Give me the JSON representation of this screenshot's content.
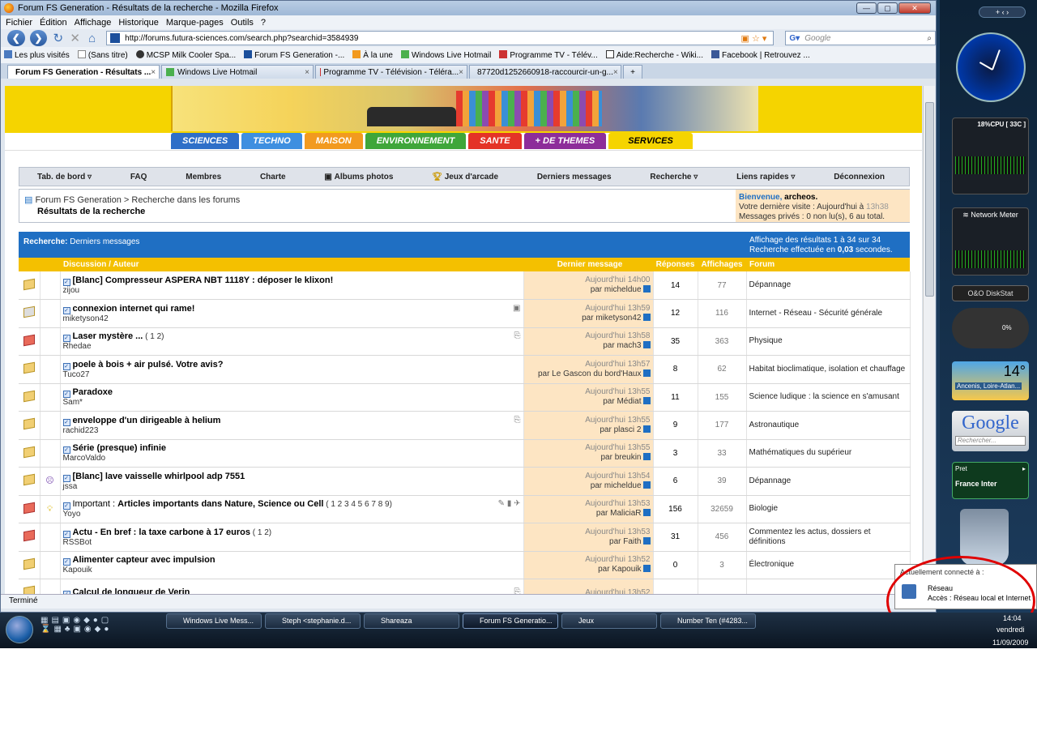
{
  "window": {
    "title": "Forum FS Generation - Résultats de la recherche - Mozilla Firefox"
  },
  "menu": [
    "Fichier",
    "Édition",
    "Affichage",
    "Historique",
    "Marque-pages",
    "Outils",
    "?"
  ],
  "url": "http://forums.futura-sciences.com/search.php?searchid=3584939",
  "search_placeholder": "Google",
  "bookmarks": [
    "Les plus visités",
    "(Sans titre)",
    "MCSP Milk Cooler Spa...",
    "Forum FS Generation -...",
    "À la une",
    "Windows Live Hotmail",
    "Programme TV - Télév...",
    "Aide:Recherche - Wiki...",
    "Facebook | Retrouvez ..."
  ],
  "tabs": [
    "Forum FS Generation - Résultats ...",
    "Windows Live Hotmail",
    "Programme TV - Télévision - Téléra...",
    "87720d1252660918-raccourcir-un-g..."
  ],
  "categories": [
    {
      "label": "SCIENCES",
      "color": "#2f6fc8"
    },
    {
      "label": "TECHNO",
      "color": "#3e8fe0"
    },
    {
      "label": "MAISON",
      "color": "#f29a1f"
    },
    {
      "label": "ENVIRONNEMENT",
      "color": "#3fa63a"
    },
    {
      "label": "SANTE",
      "color": "#e43327"
    },
    {
      "label": "+ DE THEMES",
      "color": "#8d2d9a"
    },
    {
      "label": "SERVICES",
      "color": "#f5d400"
    }
  ],
  "forumnav": [
    "Tab. de bord",
    "FAQ",
    "Membres",
    "Charte",
    "Albums photos",
    "Jeux d'arcade",
    "Derniers messages",
    "Recherche",
    "Liens rapides",
    "Déconnexion"
  ],
  "breadcrumb": {
    "root": "Forum FS Generation",
    "sep": " > ",
    "sub": "Recherche dans les forums",
    "current": "Résultats de la recherche"
  },
  "welcome": {
    "prefix": "Bienvenue, ",
    "user": "archeos.",
    "last_visit": "Votre dernière visite : Aujourd'hui à ",
    "last_time": "13h38",
    "pm": "Messages privés : 0 non lu(s), 6 au total."
  },
  "results": {
    "label": "Recherche:",
    "sub": " Derniers messages",
    "info1": "Affichage des résultats 1 à 34 sur 34",
    "info2a": "Recherche effectuée en ",
    "info2b": "0,03",
    "info2c": " secondes."
  },
  "columns": [
    "Discussion / Auteur",
    "Dernier message",
    "Réponses",
    "Affichages",
    "Forum"
  ],
  "threads": [
    {
      "title": "[Blanc] Compresseur ASPERA NBT 1118Y : déposer le klixon!",
      "pages": "",
      "author": "zijou",
      "time": "Aujourd'hui 14h00",
      "by": "par micheldue",
      "replies": "14",
      "views": "77",
      "forum": "Dépannage",
      "icon": "normal"
    },
    {
      "title": "connexion internet qui rame!",
      "pages": "",
      "author": "miketyson42",
      "time": "Aujourd'hui 13h59",
      "by": "par miketyson42",
      "replies": "12",
      "views": "116",
      "forum": "Internet - Réseau - Sécurité générale",
      "icon": "grey"
    },
    {
      "title": "Laser mystère ...",
      "pages": "( 1 2)",
      "author": "Rhedae",
      "time": "Aujourd'hui 13h58",
      "by": "par mach3",
      "replies": "35",
      "views": "363",
      "forum": "Physique",
      "icon": "red"
    },
    {
      "title": "poele à bois + air pulsé. Votre avis?",
      "pages": "",
      "author": "Tuco27",
      "time": "Aujourd'hui 13h57",
      "by": "par Le Gascon du bord'Haux",
      "replies": "8",
      "views": "62",
      "forum": "Habitat bioclimatique, isolation et chauffage",
      "icon": "normal"
    },
    {
      "title": "Paradoxe",
      "pages": "",
      "author": "Sam*",
      "time": "Aujourd'hui 13h55",
      "by": "par Médiat",
      "replies": "11",
      "views": "155",
      "forum": "Science ludique : la science en s'amusant",
      "icon": "normal"
    },
    {
      "title": "enveloppe d'un dirigeable à helium",
      "pages": "",
      "author": "rachid223",
      "time": "Aujourd'hui 13h55",
      "by": "par plasci 2",
      "replies": "9",
      "views": "177",
      "forum": "Astronautique",
      "icon": "normal"
    },
    {
      "title": "Série (presque) infinie",
      "pages": "",
      "author": "MarcoValdo",
      "time": "Aujourd'hui 13h55",
      "by": "par breukin",
      "replies": "3",
      "views": "33",
      "forum": "Mathématiques du supérieur",
      "icon": "normal"
    },
    {
      "title": "[Blanc] lave vaisselle whirlpool adp 7551",
      "pages": "",
      "author": "jssa",
      "time": "Aujourd'hui 13h54",
      "by": "par micheldue",
      "replies": "6",
      "views": "39",
      "forum": "Dépannage",
      "icon": "normal"
    },
    {
      "title": "Articles importants dans Nature, Science ou Cell",
      "prefix": "Important : ",
      "pages": "( 1 2 3 4 5 6 7 8 9)",
      "author": "Yoyo",
      "time": "Aujourd'hui 13h53",
      "by": "par MaliciaR",
      "replies": "156",
      "views": "32659",
      "forum": "Biologie",
      "icon": "red"
    },
    {
      "title": "Actu - En bref : la taxe carbone à 17 euros",
      "pages": "( 1 2)",
      "author": "RSSBot",
      "time": "Aujourd'hui 13h53",
      "by": "par Faith",
      "replies": "31",
      "views": "456",
      "forum": "Commentez les actus, dossiers et définitions",
      "icon": "red"
    },
    {
      "title": "Alimenter capteur avec impulsion",
      "pages": "",
      "author": "Kapouik",
      "time": "Aujourd'hui 13h52",
      "by": "par Kapouik",
      "replies": "0",
      "views": "3",
      "forum": "Électronique",
      "icon": "normal"
    },
    {
      "title": "Calcul de longueur de Verin",
      "pages": "",
      "author": "",
      "time": "Aujourd'hui 13h52",
      "by": "",
      "replies": "",
      "views": "",
      "forum": "",
      "icon": "normal"
    }
  ],
  "status": "Terminé",
  "sidebar": {
    "cpu": "CPU [ 33C ]",
    "cpu_pct": "18%",
    "net": "Network Meter",
    "disk": "O&O DiskStat",
    "disk_pct": "0%",
    "temp": "14°",
    "city": "Ancenis, Loire-Atlan...",
    "google": "Google",
    "google_search": "Rechercher...",
    "radio_state": "Pret",
    "radio": "France Inter"
  },
  "balloon": {
    "title": "Actuellement connecté à :",
    "name": "Réseau",
    "access": "Accès :  Réseau local et Internet"
  },
  "taskbar": {
    "tasks": [
      "Windows Live Mess...",
      "Steph <stephanie.d...",
      "Shareaza",
      "Forum FS Generatio...",
      "Jeux",
      "Number Ten (#4283..."
    ],
    "time": "14:04",
    "day": "vendredi",
    "date": "11/09/2009"
  }
}
